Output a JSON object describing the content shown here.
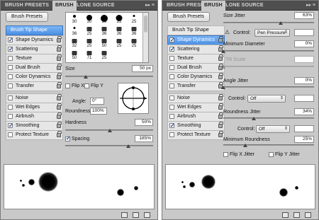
{
  "left": {
    "tabs": [
      "BRUSH PRESETS",
      "BRUSH",
      "CLONE SOURCE"
    ],
    "menu_glyph": "▸▸ ≡",
    "brush_presets_button": "Brush Presets",
    "options": [
      {
        "label": "Brush Tip Shape",
        "check": false,
        "lock": false,
        "header": true,
        "selected": true
      },
      {
        "label": "Shape Dynamics",
        "check": true,
        "lock": true
      },
      {
        "label": "Scattering",
        "check": true,
        "lock": true
      },
      {
        "label": "Texture",
        "check": false,
        "lock": true
      },
      {
        "label": "Dual Brush",
        "check": false,
        "lock": true
      },
      {
        "label": "Color Dynamics",
        "check": false,
        "lock": true
      },
      {
        "label": "Transfer",
        "check": false,
        "lock": true
      },
      {
        "label": "Noise",
        "check": false,
        "lock": true
      },
      {
        "label": "Wet Edges",
        "check": false,
        "lock": true
      },
      {
        "label": "Airbrush",
        "check": false,
        "lock": true
      },
      {
        "label": "Smoothing",
        "check": true,
        "lock": true
      },
      {
        "label": "Protect Texture",
        "check": false,
        "lock": true
      }
    ],
    "tip_numbers": [
      "30",
      "30",
      "30",
      "25",
      "25",
      "36",
      "25",
      "36",
      "36",
      "36",
      "32",
      "25",
      "50",
      "25",
      "25",
      "50",
      "71",
      "25"
    ],
    "size_label": "Size",
    "size_value": "50 px",
    "flip_x": "Flip X",
    "flip_y": "Flip Y",
    "angle_label": "Angle:",
    "angle_value": "0°",
    "roundness_label": "Roundness:",
    "roundness_value": "100%",
    "hardness_label": "Hardness",
    "hardness_value": "50%",
    "spacing_label": "Spacing",
    "spacing_value": "185%",
    "spacing_checked": true
  },
  "right": {
    "tabs": [
      "BRUSH PRESETS",
      "BRUSH",
      "CLONE SOURCE"
    ],
    "menu_glyph": "▸▸ ≡",
    "brush_presets_button": "Brush Presets",
    "options": [
      {
        "label": "Brush Tip Shape",
        "check": false,
        "lock": false,
        "header": true,
        "selected": false
      },
      {
        "label": "Shape Dynamics",
        "check": true,
        "lock": true,
        "selected": true
      },
      {
        "label": "Scattering",
        "check": true,
        "lock": true
      },
      {
        "label": "Texture",
        "check": false,
        "lock": true
      },
      {
        "label": "Dual Brush",
        "check": false,
        "lock": true
      },
      {
        "label": "Color Dynamics",
        "check": false,
        "lock": true
      },
      {
        "label": "Transfer",
        "check": false,
        "lock": true
      },
      {
        "label": "Noise",
        "check": false,
        "lock": true
      },
      {
        "label": "Wet Edges",
        "check": false,
        "lock": true
      },
      {
        "label": "Airbrush",
        "check": false,
        "lock": true
      },
      {
        "label": "Smoothing",
        "check": true,
        "lock": true
      },
      {
        "label": "Protect Texture",
        "check": false,
        "lock": true
      }
    ],
    "size_jitter_label": "Size Jitter",
    "size_jitter_value": "63%",
    "control_label": "Control:",
    "control1_value": "Pen Pressure",
    "min_diameter_label": "Minimum Diameter",
    "min_diameter_value": "0%",
    "tilt_scale_label": "Tilt Scale",
    "angle_jitter_label": "Angle Jitter",
    "angle_jitter_value": "0%",
    "control2_value": "Off",
    "roundness_jitter_label": "Roundness Jitter",
    "roundness_jitter_value": "34%",
    "control3_value": "Off",
    "min_roundness_label": "Minimum Roundness",
    "min_roundness_value": "25%",
    "flip_x_jitter": "Flip X Jitter",
    "flip_y_jitter": "Flip Y Jitter"
  }
}
